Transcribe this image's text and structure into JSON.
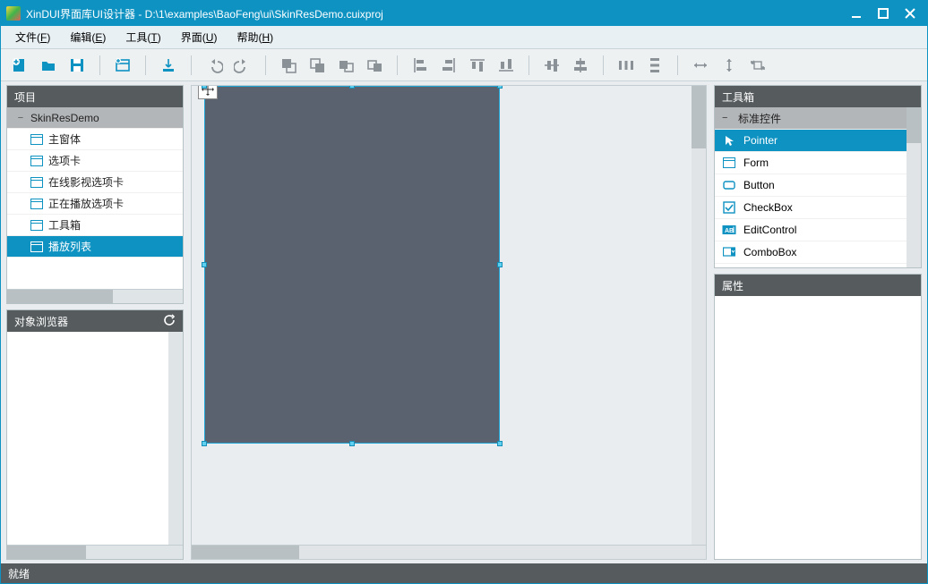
{
  "title": "XinDUI界面库UI设计器 - D:\\1\\examples\\BaoFeng\\ui\\SkinResDemo.cuixproj",
  "menus": {
    "file": "文件",
    "file_acc": "F",
    "edit": "编辑",
    "edit_acc": "E",
    "tool": "工具",
    "tool_acc": "T",
    "ui": "界面",
    "ui_acc": "U",
    "help": "帮助",
    "help_acc": "H"
  },
  "panels": {
    "project": "项目",
    "object": "对象浏览器",
    "toolbox": "工具箱",
    "properties": "属性"
  },
  "project": {
    "root": "SkinResDemo",
    "items": [
      "主窗体",
      "选项卡",
      "在线影视选项卡",
      "正在播放选项卡",
      "工具箱",
      "播放列表"
    ],
    "selected_index": 5
  },
  "toolbox": {
    "group": "标准控件",
    "items": [
      "Pointer",
      "Form",
      "Button",
      "CheckBox",
      "EditControl",
      "ComboBox"
    ],
    "selected_index": 0
  },
  "status": "就绪",
  "colors": {
    "accent": "#0d92c2"
  }
}
